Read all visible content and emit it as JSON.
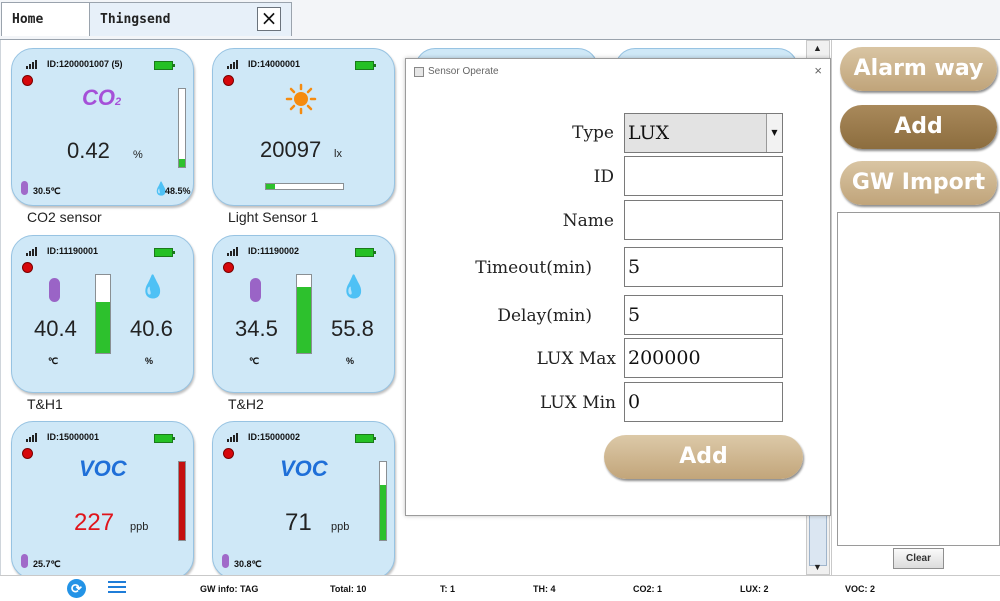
{
  "tabs": [
    {
      "label": "Home"
    },
    {
      "label": "Thingsend",
      "close": "×"
    }
  ],
  "cards": [
    {
      "id": "ID:1200001007  (5)",
      "type": "co2",
      "logo": "CO",
      "logo_sub": "2",
      "value": "0.42",
      "unit": "%",
      "temp": "30.5℃",
      "hum": "48.5%",
      "caption": "CO2 sensor",
      "level": 0.1
    },
    {
      "id": "ID:14000001",
      "type": "light",
      "value": "20097",
      "unit": "lx",
      "caption": "Light Sensor 1",
      "level": 0.12
    },
    {
      "id": "ID:11190001",
      "type": "th",
      "temp_value": "40.4",
      "temp_unit": "℃",
      "hum_value": "40.6",
      "hum_unit": "%",
      "caption": "T&H1",
      "level": 0.65
    },
    {
      "id": "ID:11190002",
      "type": "th",
      "temp_value": "34.5",
      "temp_unit": "℃",
      "hum_value": "55.8",
      "hum_unit": "%",
      "caption": "T&H2",
      "level": 0.84
    },
    {
      "id": "ID:15000001",
      "type": "voc",
      "logo": "VOC",
      "value": "227",
      "unit": "ppb",
      "temp": "25.7℃",
      "value_color": "#e0141b",
      "bar_color": "#c41010",
      "level": 1.0
    },
    {
      "id": "ID:15000002",
      "type": "voc",
      "logo": "VOC",
      "value": "71",
      "unit": "ppb",
      "temp": "30.8℃",
      "value_color": "#222222",
      "bar_color": "#2dc12d",
      "level": 0.7
    }
  ],
  "dialog": {
    "title": "Sensor Operate",
    "close": "×",
    "fields": [
      {
        "label": "Type",
        "value": "LUX",
        "kind": "select"
      },
      {
        "label": "ID",
        "value": ""
      },
      {
        "label": "Name",
        "value": ""
      },
      {
        "label": "Timeout(min)",
        "value": "5"
      },
      {
        "label": "Delay(min)",
        "value": "5"
      },
      {
        "label": "LUX Max",
        "value": "200000"
      },
      {
        "label": "LUX Min",
        "value": "0"
      }
    ],
    "add_label": "Add"
  },
  "right_panel": {
    "alarm_label": "Alarm way",
    "add_label": "Add",
    "gw_import_label": "GW Import",
    "clear_label": "Clear"
  },
  "status": {
    "gw_info": "GW info: TAG",
    "total": "Total: 10",
    "t": "T:  1",
    "th": "TH:  4",
    "co2": "CO2:  1",
    "lux": "LUX:  2",
    "voc": "VOC:  2"
  },
  "colors": {
    "card_bg": "#cfe8f7",
    "accent_blue": "#1f6fd8",
    "brown_button": "#c2a57a",
    "brown_button_dark": "#8c6d3e",
    "status_red": "#d6070b",
    "battery_green": "#25c025"
  }
}
